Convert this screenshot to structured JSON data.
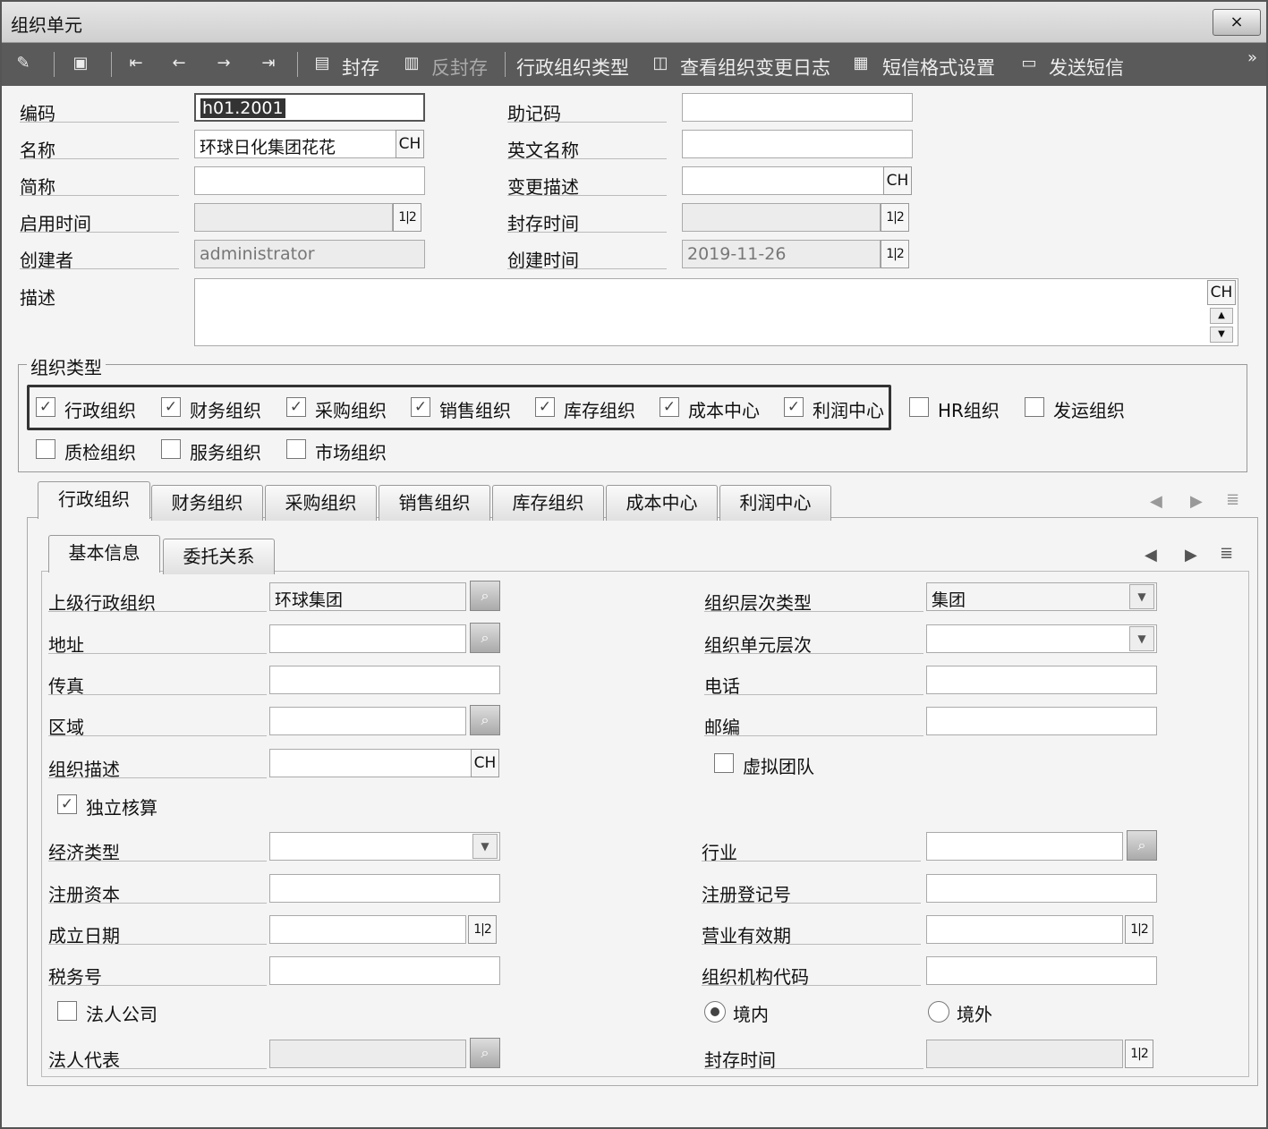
{
  "window": {
    "title": "组织单元",
    "close_label": "×"
  },
  "toolbar": {
    "seal": "封存",
    "unseal": "反封存",
    "admin_org_type": "行政组织类型",
    "view_change_log": "查看组织变更日志",
    "sms_format": "短信格式设置",
    "send_sms": "发送短信",
    "more": "»"
  },
  "form": {
    "code_label": "编码",
    "code_value": "h01.2001",
    "mnemonic_label": "助记码",
    "mnemonic_value": "",
    "name_label": "名称",
    "name_value": "环球日化集团花花",
    "en_name_label": "英文名称",
    "en_name_value": "",
    "short_label": "简称",
    "short_value": "",
    "change_desc_label": "变更描述",
    "change_desc_value": "",
    "enable_time_label": "启用时间",
    "enable_time_value": "",
    "seal_time_label": "封存时间",
    "seal_time_value": "",
    "creator_label": "创建者",
    "creator_value": "administrator",
    "create_time_label": "创建时间",
    "create_time_value": "2019-11-26",
    "desc_label": "描述",
    "desc_value": "",
    "ch": "CH",
    "cal": "1|2"
  },
  "org_types": {
    "title": "组织类型",
    "items": [
      {
        "label": "行政组织",
        "checked": true
      },
      {
        "label": "财务组织",
        "checked": true
      },
      {
        "label": "采购组织",
        "checked": true
      },
      {
        "label": "销售组织",
        "checked": true
      },
      {
        "label": "库存组织",
        "checked": true
      },
      {
        "label": "成本中心",
        "checked": true
      },
      {
        "label": "利润中心",
        "checked": true
      },
      {
        "label": "HR组织",
        "checked": false
      },
      {
        "label": "发运组织",
        "checked": false
      },
      {
        "label": "质检组织",
        "checked": false
      },
      {
        "label": "服务组织",
        "checked": false
      },
      {
        "label": "市场组织",
        "checked": false
      }
    ]
  },
  "tabs": [
    "行政组织",
    "财务组织",
    "采购组织",
    "销售组织",
    "库存组织",
    "成本中心",
    "利润中心"
  ],
  "subtabs": [
    "基本信息",
    "委托关系"
  ],
  "detail": {
    "parent_org_label": "上级行政组织",
    "parent_org_value": "环球集团",
    "level_type_label": "组织层次类型",
    "level_type_value": "集团",
    "address_label": "地址",
    "address_value": "",
    "unit_level_label": "组织单元层次",
    "unit_level_value": "",
    "fax_label": "传真",
    "fax_value": "",
    "phone_label": "电话",
    "phone_value": "",
    "region_label": "区域",
    "region_value": "",
    "zip_label": "邮编",
    "zip_value": "",
    "org_desc_label": "组织描述",
    "org_desc_value": "",
    "virtual_team_label": "虚拟团队",
    "virtual_team_checked": false,
    "independent_label": "独立核算",
    "independent_checked": true,
    "econ_type_label": "经济类型",
    "econ_type_value": "",
    "industry_label": "行业",
    "industry_value": "",
    "reg_capital_label": "注册资本",
    "reg_capital_value": "",
    "reg_no_label": "注册登记号",
    "reg_no_value": "",
    "found_date_label": "成立日期",
    "found_date_value": "",
    "biz_valid_label": "营业有效期",
    "biz_valid_value": "",
    "tax_no_label": "税务号",
    "tax_no_value": "",
    "org_code_label": "组织机构代码",
    "org_code_value": "",
    "legal_company_label": "法人公司",
    "legal_company_checked": false,
    "domestic_label": "境内",
    "domestic_selected": true,
    "overseas_label": "境外",
    "overseas_selected": false,
    "legal_rep_label": "法人代表",
    "legal_rep_value": "",
    "seal_time_label": "封存时间",
    "seal_time_value": ""
  }
}
